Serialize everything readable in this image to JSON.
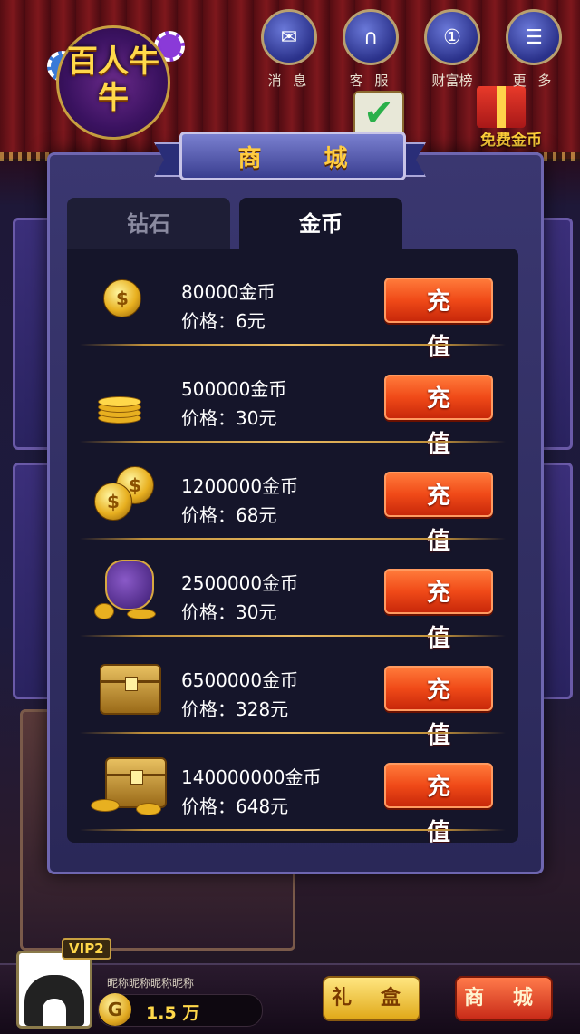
{
  "app": {
    "logo_text": "百人牛牛"
  },
  "topnav": {
    "items": [
      {
        "label": "消 息",
        "icon": "envelope-icon"
      },
      {
        "label": "客 服",
        "icon": "headset-icon"
      },
      {
        "label": "财富榜",
        "icon": "medal-icon"
      },
      {
        "label": "更 多",
        "icon": "menu-list-icon"
      }
    ]
  },
  "free_coin_label": "免费金币",
  "shop": {
    "title": "商 城",
    "tabs": [
      {
        "label": "钻石",
        "active": false
      },
      {
        "label": "金币",
        "active": true
      }
    ],
    "items": [
      {
        "name": "80000金币",
        "price": "价格：6元",
        "button": "充 值",
        "icon": "single-coin-icon"
      },
      {
        "name": "500000金币",
        "price": "价格：30元",
        "button": "充 值",
        "icon": "coin-stack-icon"
      },
      {
        "name": "1200000金币",
        "price": "价格：68元",
        "button": "充 值",
        "icon": "coin-pile-icon"
      },
      {
        "name": "2500000金币",
        "price": "价格：30元",
        "button": "充 值",
        "icon": "coin-bag-icon"
      },
      {
        "name": "6500000金币",
        "price": "价格：328元",
        "button": "充 值",
        "icon": "treasure-chest-icon"
      },
      {
        "name": "140000000金币",
        "price": "价格：648元",
        "button": "充 值",
        "icon": "treasure-chest-large-icon"
      }
    ]
  },
  "player": {
    "vip": "VIP2",
    "nickname": "昵称昵称昵称昵称",
    "coins": "1.5 万",
    "coin_symbol": "G"
  },
  "bottom_buttons": {
    "gift": "礼 盒",
    "shop": "商 城"
  },
  "colors": {
    "buy_button": "#f04a18",
    "title_gold": "#ffcc40",
    "panel": "#2a2858"
  }
}
